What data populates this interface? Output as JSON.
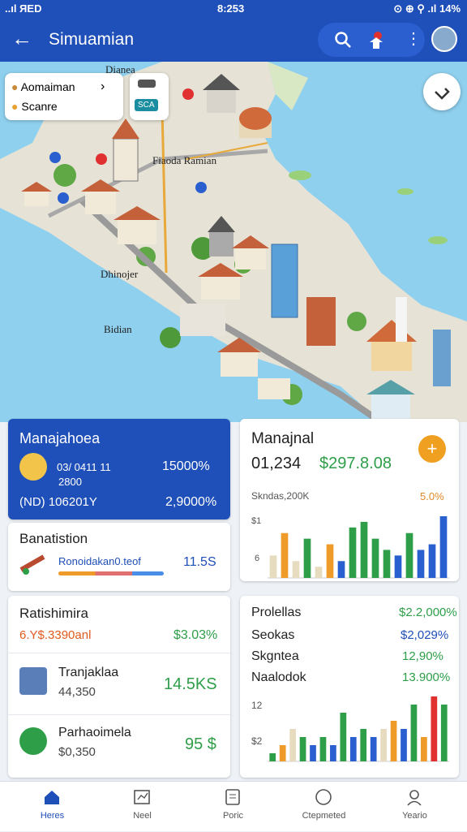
{
  "status_bar": {
    "left": "..ıl ЯЕD",
    "center": "8:253",
    "right": "⊙ ⊕ ⚲ .ıl 14%"
  },
  "header": {
    "title": "Simuamian",
    "back_icon": "arrow-left-icon",
    "search_icon": "search-icon",
    "pin_icon": "map-pin-icon",
    "more_icon": "more-vert-icon"
  },
  "map": {
    "search": {
      "origin": "Aomaiman",
      "destination": "Scanre"
    },
    "swap_label": "SCA",
    "labels": [
      "Dianea",
      "Fiaoda Ramian",
      "Dhinojer",
      "Bidian"
    ]
  },
  "cards": {
    "manajahoea": {
      "title": "Manajahoea",
      "val1": "03/ 0411 11",
      "val1b": "2800",
      "pct1": "15000%",
      "val2": "(ND) 106201Y",
      "pct2": "2,9000%"
    },
    "manajnal": {
      "title": "Manajnal",
      "amount1": "01,234",
      "amount2": "$297.8.08",
      "sub": "Skndas,200K",
      "pct": "5.0%",
      "axis_top": "$1",
      "axis_mid": "6"
    },
    "banatistion": {
      "title": "Banatistion",
      "label": "Ronoidakan0.teof",
      "value": "11.5S"
    },
    "ratishimira": {
      "title": "Ratishimira",
      "sub": "6.Y$.3390anl",
      "pct": "$3.03%",
      "items": [
        {
          "name": "Tranjaklaa",
          "amount": "44,350",
          "value": "14.5KS"
        },
        {
          "name": "Parhaoimela",
          "amount": "$0,350",
          "value": "95 $"
        }
      ]
    },
    "prolellas": {
      "rows": [
        {
          "label": "Prolellas",
          "value": "$2.2,000%"
        },
        {
          "label": "Seokas",
          "value": "$2,029%"
        },
        {
          "label": "Skgntea",
          "value": "12,90%"
        },
        {
          "label": "Naalodok",
          "value": "13.900%"
        }
      ],
      "axis_top": "12",
      "axis_bottom": "$2"
    }
  },
  "bottom_nav": [
    {
      "label": "Heres",
      "icon": "home-icon",
      "active": true
    },
    {
      "label": "Neel",
      "icon": "map-icon",
      "active": false
    },
    {
      "label": "Poric",
      "icon": "document-icon",
      "active": false
    },
    {
      "label": "Ctepmeted",
      "icon": "compass-icon",
      "active": false
    },
    {
      "label": "Yeario",
      "icon": "profile-icon",
      "active": false
    }
  ],
  "colors": {
    "primary": "#1f4fb8",
    "green": "#2e9e48",
    "orange": "#ee9b2a",
    "blue": "#2a5fcf",
    "beige": "#e8dcc0"
  },
  "chart_data": [
    {
      "type": "bar",
      "name": "manajnal-chart",
      "values": [
        4,
        8,
        3,
        7,
        2,
        6,
        3,
        9,
        10,
        7,
        5,
        4,
        8,
        5,
        6,
        11
      ],
      "colors": [
        "beige",
        "orange",
        "beige",
        "green",
        "beige",
        "orange",
        "blue",
        "green",
        "green",
        "green",
        "green",
        "blue",
        "green",
        "blue",
        "blue",
        "blue"
      ]
    },
    {
      "type": "bar",
      "name": "prolellas-chart",
      "values": [
        1,
        2,
        4,
        3,
        2,
        3,
        2,
        6,
        3,
        4,
        3,
        4,
        5,
        4,
        7,
        3,
        8,
        7
      ],
      "colors": [
        "green",
        "orange",
        "beige",
        "green",
        "blue",
        "green",
        "blue",
        "green",
        "blue",
        "green",
        "blue",
        "beige",
        "orange",
        "blue",
        "green",
        "orange",
        "red",
        "green"
      ]
    }
  ]
}
